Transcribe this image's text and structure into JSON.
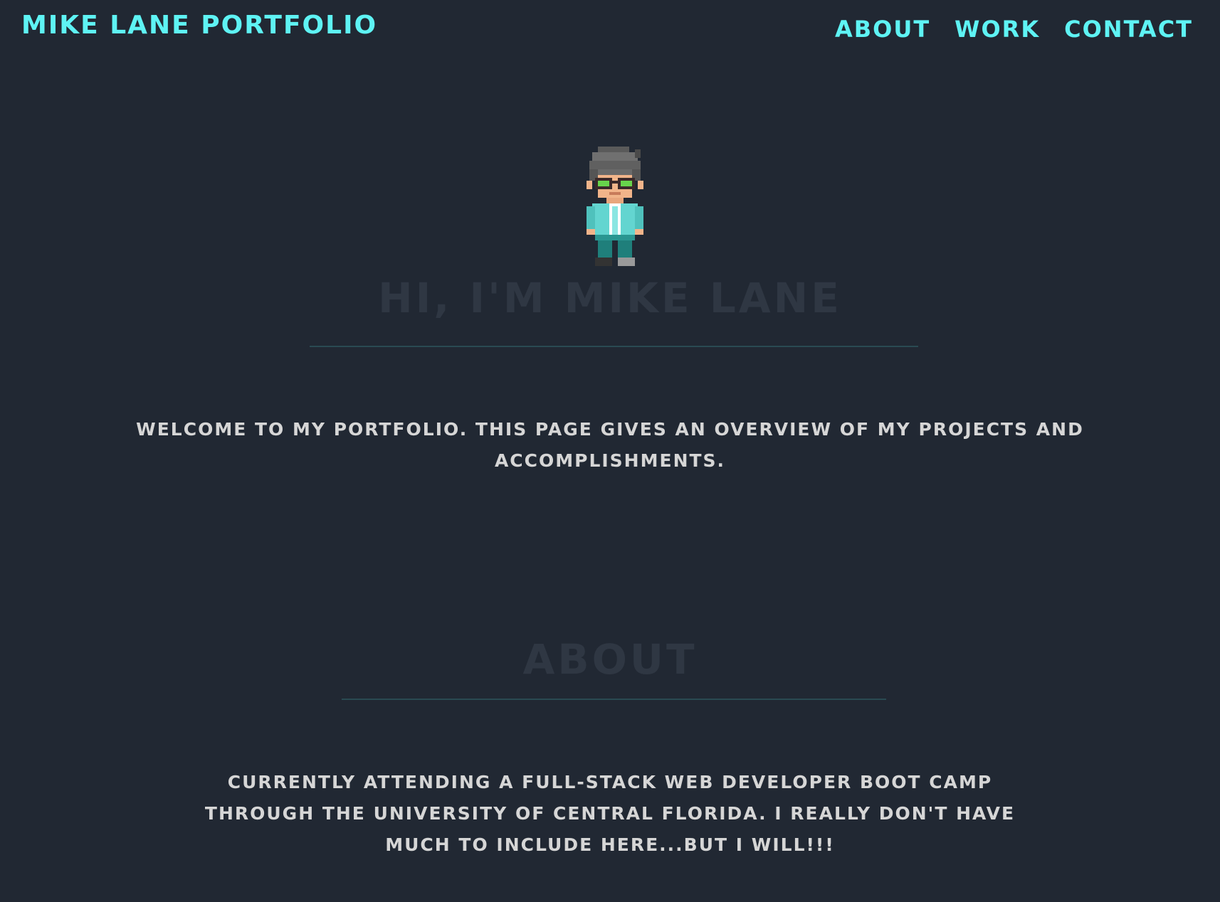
{
  "header": {
    "brand": "MIKE LANE PORTFOLIO",
    "nav": [
      {
        "label": "ABOUT"
      },
      {
        "label": "WORK"
      },
      {
        "label": "CONTACT"
      }
    ]
  },
  "hero": {
    "avatar": "pixel-art-character",
    "title": "HI, I'M MIKE LANE",
    "intro": "WELCOME TO MY PORTFOLIO. THIS PAGE GIVES AN OVERVIEW OF MY PROJECTS AND ACCOMPLISHMENTS."
  },
  "about": {
    "title": "ABOUT",
    "text": "CURRENTLY ATTENDING A FULL-STACK WEB DEVELOPER BOOT CAMP THROUGH THE UNIVERSITY OF CENTRAL FLORIDA. I REALLY DON'T HAVE MUCH TO INCLUDE HERE...BUT I WILL!!!"
  },
  "colors": {
    "background": "#212833",
    "accent": "#5ef3f4",
    "heading_muted": "#2f3743",
    "body_text": "#d6d6d6",
    "divider": "#2a4a52"
  }
}
